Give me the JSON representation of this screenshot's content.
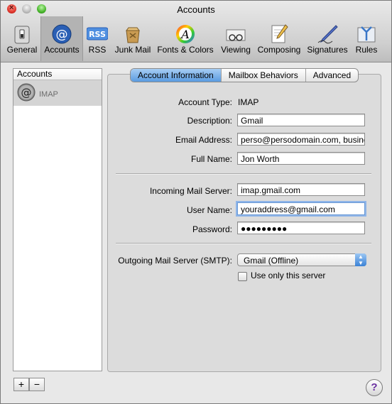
{
  "window": {
    "title": "Accounts"
  },
  "toolbar": {
    "items": [
      {
        "label": "General",
        "icon": "switch-icon"
      },
      {
        "label": "Accounts",
        "icon": "at-icon"
      },
      {
        "label": "RSS",
        "icon": "rss-icon"
      },
      {
        "label": "Junk Mail",
        "icon": "junk-mail-icon"
      },
      {
        "label": "Fonts & Colors",
        "icon": "fonts-colors-icon"
      },
      {
        "label": "Viewing",
        "icon": "viewing-icon"
      },
      {
        "label": "Composing",
        "icon": "composing-icon"
      },
      {
        "label": "Signatures",
        "icon": "signatures-icon"
      },
      {
        "label": "Rules",
        "icon": "rules-icon"
      }
    ],
    "selected": "Accounts"
  },
  "sidebar": {
    "header": "Accounts",
    "accounts": [
      {
        "label": "IMAP",
        "icon": "at-icon"
      }
    ],
    "add_label": "+",
    "remove_label": "−"
  },
  "tabs": [
    {
      "label": "Account Information",
      "active": true
    },
    {
      "label": "Mailbox Behaviors",
      "active": false
    },
    {
      "label": "Advanced",
      "active": false
    }
  ],
  "form": {
    "account_type_label": "Account Type:",
    "account_type_value": "IMAP",
    "description_label": "Description:",
    "description_value": "Gmail",
    "email_label": "Email Address:",
    "email_value": "perso@persodomain.com, business",
    "fullname_label": "Full Name:",
    "fullname_value": "Jon Worth",
    "incoming_label": "Incoming Mail Server:",
    "incoming_value": "imap.gmail.com",
    "username_label": "User Name:",
    "username_value": "youraddress@gmail.com",
    "password_label": "Password:",
    "password_value": "●●●●●●●●●",
    "smtp_label": "Outgoing Mail Server (SMTP):",
    "smtp_value": "Gmail (Offline)",
    "use_only_label": "Use only this server",
    "use_only_checked": false
  },
  "help": {
    "label": "?"
  },
  "colors": {
    "accent": "#5a9be0",
    "selection": "#d4d4d4"
  }
}
